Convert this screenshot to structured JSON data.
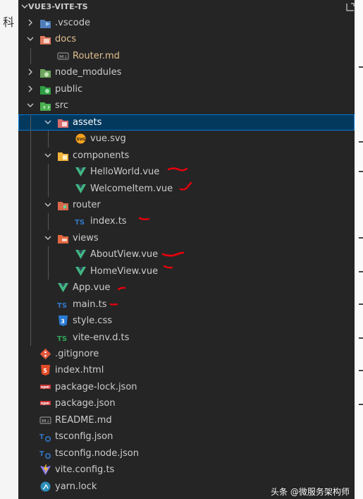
{
  "explorer": {
    "title": "VUE3-VITE-TS",
    "items": [
      {
        "label": ".vscode",
        "icon": "vscode-folder-icon",
        "expanded": false
      },
      {
        "label": "docs",
        "icon": "docs-folder-icon",
        "expanded": true,
        "modified": true
      },
      {
        "label": "Router.md",
        "icon": "markdown-icon",
        "modified": true
      },
      {
        "label": "node_modules",
        "icon": "node-folder-icon",
        "expanded": false
      },
      {
        "label": "public",
        "icon": "public-folder-icon",
        "expanded": false
      },
      {
        "label": "src",
        "icon": "src-folder-icon",
        "expanded": true
      },
      {
        "label": "assets",
        "icon": "assets-folder-icon",
        "expanded": true,
        "selected": true
      },
      {
        "label": "vue.svg",
        "icon": "svg-icon"
      },
      {
        "label": "components",
        "icon": "components-folder-icon",
        "expanded": true
      },
      {
        "label": "HelloWorld.vue",
        "icon": "vue-icon"
      },
      {
        "label": "WelcomeItem.vue",
        "icon": "vue-icon"
      },
      {
        "label": "router",
        "icon": "router-folder-icon",
        "expanded": true
      },
      {
        "label": "index.ts",
        "icon": "typescript-icon"
      },
      {
        "label": "views",
        "icon": "views-folder-icon",
        "expanded": true
      },
      {
        "label": "AboutView.vue",
        "icon": "vue-icon"
      },
      {
        "label": "HomeView.vue",
        "icon": "vue-icon"
      },
      {
        "label": "App.vue",
        "icon": "vue-icon"
      },
      {
        "label": "main.ts",
        "icon": "typescript-icon"
      },
      {
        "label": "style.css",
        "icon": "css-icon"
      },
      {
        "label": "vite-env.d.ts",
        "icon": "typescript-def-icon"
      },
      {
        "label": ".gitignore",
        "icon": "git-icon"
      },
      {
        "label": "index.html",
        "icon": "html-icon"
      },
      {
        "label": "package-lock.json",
        "icon": "npm-icon"
      },
      {
        "label": "package.json",
        "icon": "npm-icon"
      },
      {
        "label": "README.md",
        "icon": "markdown-icon"
      },
      {
        "label": "tsconfig.json",
        "icon": "tsconfig-icon"
      },
      {
        "label": "tsconfig.node.json",
        "icon": "tsconfig-icon"
      },
      {
        "label": "vite.config.ts",
        "icon": "vite-icon"
      },
      {
        "label": "yarn.lock",
        "icon": "yarn-icon"
      }
    ]
  },
  "background_doc": {
    "char": "科"
  },
  "watermark": "头条 @微服务架构师",
  "colors": {
    "panel_bg": "#252526",
    "selection_bg": "#04395e",
    "selection_border": "#0078d4",
    "modified_text": "#e2c08d",
    "vue_green": "#41b883",
    "ts_blue": "#3178c6",
    "annotation_red": "#e8000b"
  }
}
